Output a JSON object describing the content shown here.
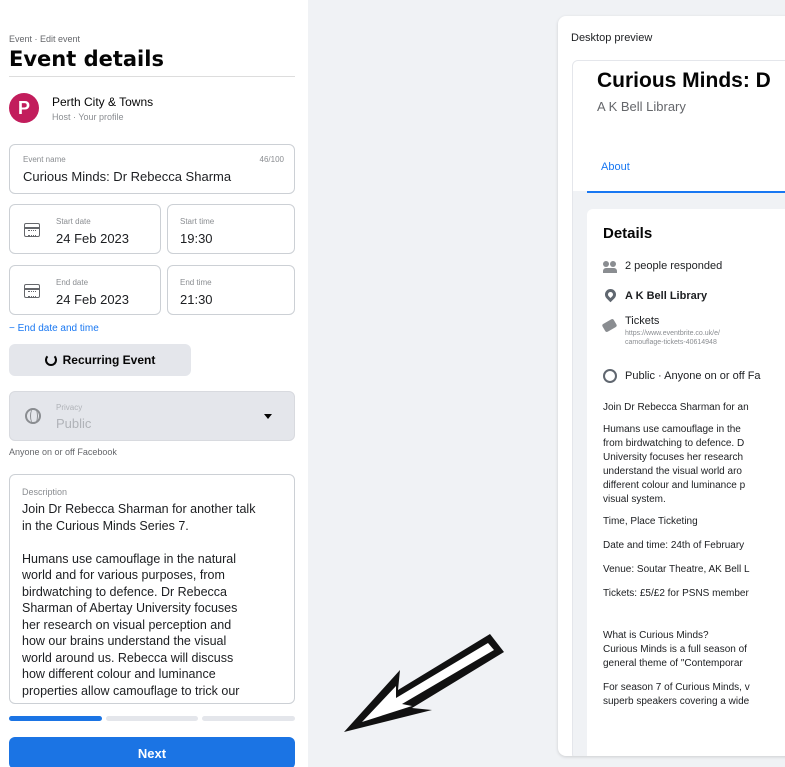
{
  "left": {
    "breadcrumb": "Event · Edit event",
    "title": "Event details",
    "host": {
      "avatar_letter": "P",
      "name": "Perth City & Towns",
      "sub": "Host · Your profile"
    },
    "event_name": {
      "label": "Event name",
      "counter": "46/100",
      "value": "Curious Minds: Dr Rebecca Sharma"
    },
    "start_date": {
      "label": "Start date",
      "value": "24 Feb 2023"
    },
    "start_time": {
      "label": "Start time",
      "value": "19:30"
    },
    "end_date": {
      "label": "End date",
      "value": "24 Feb 2023"
    },
    "end_time": {
      "label": "End time",
      "value": "21:30"
    },
    "end_link": "− End date and time",
    "recurring": "Recurring Event",
    "privacy": {
      "label": "Privacy",
      "value": "Public",
      "help": "Anyone on or off Facebook"
    },
    "description": {
      "label": "Description",
      "text": "Join Dr Rebecca Sharman for another talk\nin the Curious Minds Series 7.\n\nHumans use camouflage in the natural\nworld and for various purposes, from\nbirdwatching to defence. Dr Rebecca\nSharman of Abertay University focuses\nher research on visual perception and\nhow our brains understand the visual\nworld around us. Rebecca will discuss\nhow different colour and luminance\nproperties allow camouflage to trick our"
    },
    "progress_fraction": 0.333,
    "next": "Next"
  },
  "preview": {
    "label": "Desktop preview",
    "title": "Curious Minds: D",
    "location": "A K Bell Library",
    "tab": "About",
    "details_title": "Details",
    "responded": "2 people responded",
    "venue": "A K Bell Library",
    "tickets_label": "Tickets",
    "tickets_url_1": "https://www.eventbrite.co.uk/e/",
    "tickets_url_2": "camouflage-tickets-40614948",
    "public": "Public · Anyone on or off Fa",
    "p1": "Join Dr Rebecca Sharman for an",
    "p2_1": "Humans use camouflage in the",
    "p2_2": "from birdwatching to defence. D",
    "p2_3": "University focuses her research",
    "p2_4": "understand the visual world aro",
    "p2_5": "different colour and luminance p",
    "p2_6": "visual system.",
    "p3": "Time, Place Ticketing",
    "p4": "Date and time: 24th of February",
    "p5": "Venue: Soutar Theatre, AK Bell L",
    "p6": "Tickets: £5/£2 for PSNS member",
    "p7_1": "What is Curious Minds?",
    "p7_2": "Curious Minds is a full season of",
    "p7_3": "general theme of \"Contemporar",
    "p8_1": "For season 7 of Curious Minds, v",
    "p8_2": "superb speakers covering a wide"
  },
  "colors": {
    "accent": "#1b74e4",
    "avatar": "#c21d5c"
  }
}
